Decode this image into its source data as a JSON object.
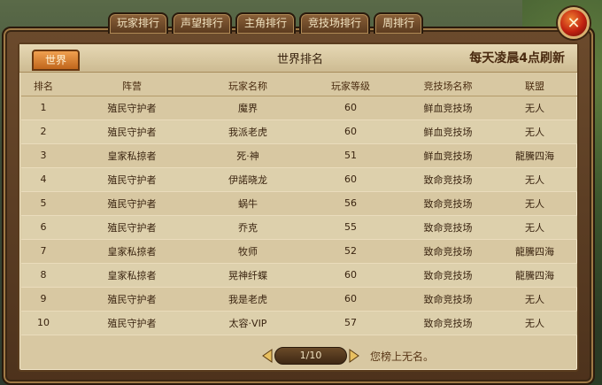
{
  "tabs": [
    "玩家排行",
    "声望排行",
    "主角排行",
    "竞技场排行",
    "周排行"
  ],
  "close_icon": "close-icon",
  "close_glyph": "✕",
  "panel": {
    "world_tab": "世界",
    "title": "世界排名",
    "refresh_note": "每天凌晨4点刷新"
  },
  "table": {
    "headers": [
      "排名",
      "阵营",
      "玩家名称",
      "玩家等级",
      "竞技场名称",
      "联盟"
    ],
    "rows": [
      [
        "1",
        "殖民守护者",
        "魔界",
        "60",
        "鲜血竞技场",
        "无人"
      ],
      [
        "2",
        "殖民守护者",
        "我派老虎",
        "60",
        "鲜血竞技场",
        "无人"
      ],
      [
        "3",
        "皇家私掠者",
        "死·神",
        "51",
        "鲜血竞技场",
        "龍騰四海"
      ],
      [
        "4",
        "殖民守护者",
        "伊諾晓龙",
        "60",
        "致命竞技场",
        "无人"
      ],
      [
        "5",
        "殖民守护者",
        "蜗牛",
        "56",
        "致命竞技场",
        "无人"
      ],
      [
        "6",
        "殖民守护者",
        "乔克",
        "55",
        "致命竞技场",
        "无人"
      ],
      [
        "7",
        "皇家私掠者",
        "牧师",
        "52",
        "致命竞技场",
        "龍騰四海"
      ],
      [
        "8",
        "皇家私掠者",
        "晃神纤蝶",
        "60",
        "致命竞技场",
        "龍騰四海"
      ],
      [
        "9",
        "殖民守护者",
        "我是老虎",
        "60",
        "致命竞技场",
        "无人"
      ],
      [
        "10",
        "殖民守护者",
        "太容·VIP",
        "57",
        "致命竞技场",
        "无人"
      ]
    ]
  },
  "pager": {
    "page": "1/10",
    "prev_icon": "left-arrow-icon",
    "next_icon": "right-arrow-icon"
  },
  "your_rank": "您榜上无名。",
  "colors": {
    "frame": "#5a3c1e",
    "panel": "#d8c8a2",
    "accent": "#c0661c",
    "close": "#c02010"
  }
}
